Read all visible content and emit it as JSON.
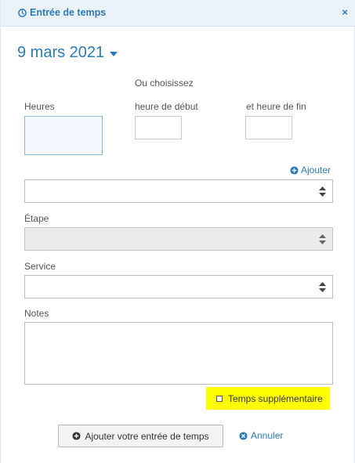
{
  "header": {
    "title": "Entrée de temps",
    "title_icon": "clock-icon",
    "close_label": "×"
  },
  "date": {
    "label": "9 mars 2021",
    "icon": "caret-down-icon"
  },
  "hours": {
    "or_choose_label": "Ou choisissez",
    "hours_label": "Heures",
    "start_label": "heure de début",
    "end_label": "et heure de fin",
    "hours_value": "",
    "start_value": "",
    "end_value": ""
  },
  "project": {
    "add_label": "Ajouter",
    "value": ""
  },
  "step": {
    "label": "Étape",
    "value": ""
  },
  "service": {
    "label": "Service",
    "value": ""
  },
  "notes": {
    "label": "Notes",
    "value": ""
  },
  "overtime": {
    "label": "Temps supplémentaire",
    "checked": false,
    "highlight_color": "#ffff00"
  },
  "actions": {
    "submit_label": "Ajouter votre entrée de temps",
    "cancel_label": "Annuler"
  },
  "colors": {
    "accent": "#2b7bb9",
    "header_bg": "#eaf1f9"
  }
}
